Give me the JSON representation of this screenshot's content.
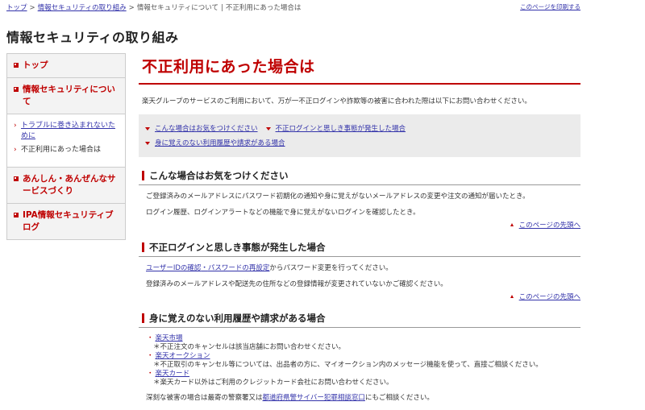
{
  "breadcrumb": {
    "items": [
      "トップ",
      "情報セキュリティの取り組み",
      "情報セキュリティについて",
      "不正利用にあった場合は"
    ],
    "separator": ">",
    "divider": "|"
  },
  "print_link": "このページを印刷する",
  "site_title": "情報セキュリティの取り組み",
  "sidebar": {
    "top": "トップ",
    "about": "情報セキュリティについて",
    "sub_items": [
      "トラブルに巻き込まれないために",
      "不正利用にあった場合は"
    ],
    "anshin": "あんしん・あんぜんなサービスづくり",
    "ipa": "IPA情報セキュリティブログ"
  },
  "page_title": "不正利用にあった場合は",
  "intro": "楽天グループのサービスのご利用において、万が一不正ログインや詐欺等の被害に合われた際は以下にお問い合わせください。",
  "anchors": [
    "こんな場合はお気をつけください",
    "不正ログインと思しき事態が発生した場合",
    "身に覚えのない利用履歴や請求がある場合"
  ],
  "section1": {
    "title": "こんな場合はお気をつけください",
    "lines": [
      "ご登録済みのメールアドレスにパスワード初期化の通知や身に覚えがないメールアドレスの変更や注文の通知が届いたとき。",
      "ログイン履歴、ログインアラートなどの機能で身に覚えがないログインを確認したとき。"
    ]
  },
  "pagetop": "このページの先頭へ",
  "section2": {
    "title": "不正ログインと思しき事態が発生した場合",
    "link1": "ユーザーIDの確認",
    "mid": "・",
    "link2": "パスワードの再設定",
    "rest": "からパスワード変更を行ってください。",
    "line2": "登録済みのメールアドレスや配送先の住所などの登録情報が変更されていないかご確認ください。"
  },
  "section3": {
    "title": "身に覚えのない利用履歴や請求がある場合",
    "bullet": "・",
    "items": [
      {
        "name": "楽天市場",
        "note": "＊不正注文のキャンセルは該当店舗にお問い合わせください。"
      },
      {
        "name": "楽天オークション",
        "note": "＊不正取引のキャンセル等については、出品者の方に、マイオークション内のメッセージ機能を使って、直接ご相談ください。"
      },
      {
        "name": "楽天カード",
        "note": "＊楽天カード以外はご利用のクレジットカード会社にお問い合わせください。"
      }
    ],
    "final_pre": "深刻な被害の場合は最寄の警察署又は",
    "final_link": "都道府県警サイバー犯罪相談窓口",
    "final_post": "にもご相談ください。"
  }
}
